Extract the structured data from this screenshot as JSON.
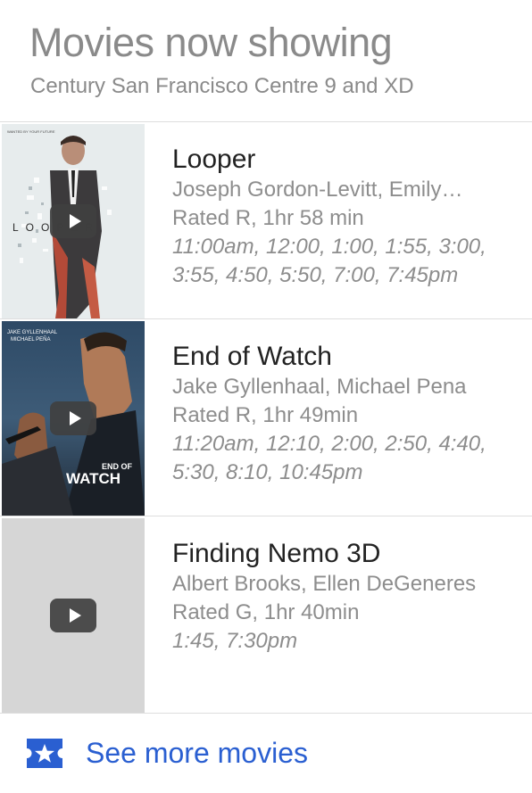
{
  "header": {
    "title": "Movies now showing",
    "subtitle": "Century San Francisco Centre 9 and XD"
  },
  "movies": [
    {
      "title": "Looper",
      "cast": "Joseph Gordon-Levitt, Emily…",
      "rating": "Rated R, 1hr 58 min",
      "times": "11:00am, 12:00, 1:00, 1:55, 3:00, 3:55, 4:50, 5:50, 7:00, 7:45pm",
      "poster_text": "LOOPER"
    },
    {
      "title": "End of Watch",
      "cast": "Jake Gyllenhaal, Michael Pena",
      "rating": "Rated R, 1hr 49min",
      "times": "11:20am, 12:10, 2:00, 2:50, 4:40, 5:30, 8:10, 10:45pm",
      "poster_text": "END OF WATCH"
    },
    {
      "title": "Finding Nemo 3D",
      "cast": "Albert Brooks, Ellen DeGeneres",
      "rating": "Rated G, 1hr 40min",
      "times": "1:45, 7:30pm",
      "poster_text": ""
    }
  ],
  "footer": {
    "link_label": "See more movies",
    "icon": "ticket-star-icon"
  },
  "colors": {
    "link": "#2a5fd1",
    "muted_text": "#8d8d8d",
    "title_text": "#222222",
    "divider": "#dedede"
  }
}
